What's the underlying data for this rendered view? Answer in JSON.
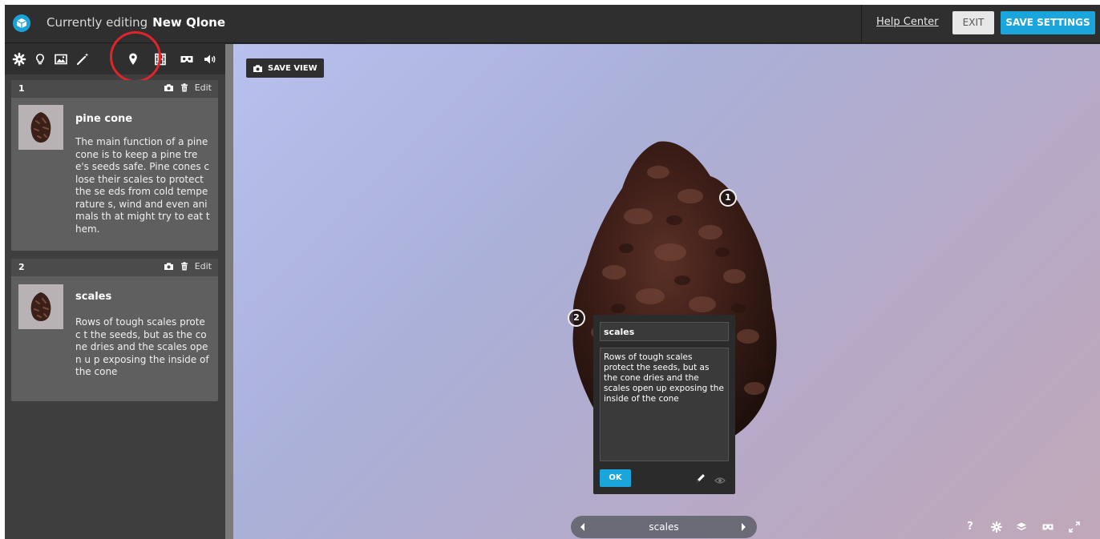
{
  "topbar": {
    "editing_prefix": "Currently editing",
    "model_name": "New Qlone",
    "help_link": "Help Center",
    "exit_label": "EXIT",
    "save_label": "SAVE SETTINGS"
  },
  "toolbar": {
    "tools": [
      "settings-icon",
      "light-bulb-icon",
      "image-icon",
      "magic-wand-icon",
      "map-pin-icon",
      "film-icon",
      "vr-headset-icon",
      "sound-icon"
    ],
    "active_tool": "map-pin-icon"
  },
  "annotations": [
    {
      "number": "1",
      "title": "pine cone",
      "edit_label": "Edit",
      "description": "The main function of a pine cone is to keep a pine tree's seeds safe. Pine cones close their scales to protect the se eds from cold temperature s, wind and even animals th at might try to eat them."
    },
    {
      "number": "2",
      "title": "scales",
      "edit_label": "Edit",
      "description": "Rows of tough scales protec t the seeds, but as the cone dries and the scales open u p exposing the inside of the cone"
    }
  ],
  "viewer": {
    "save_view_label": "SAVE VIEW",
    "hotspots": [
      "1",
      "2"
    ],
    "editor": {
      "title_value": "scales",
      "body_value": "Rows of tough scales protect the seeds, but as the cone dries and the scales open up exposing the inside of the cone",
      "ok_label": "OK"
    },
    "nav_label": "scales",
    "bottom_tools": [
      "help-icon",
      "settings-icon",
      "layers-icon",
      "vr-icon",
      "fullscreen-icon"
    ],
    "bottom_help_glyph": "?"
  },
  "colors": {
    "accent": "#1aa6dd",
    "highlight_ring": "#e0242b"
  }
}
